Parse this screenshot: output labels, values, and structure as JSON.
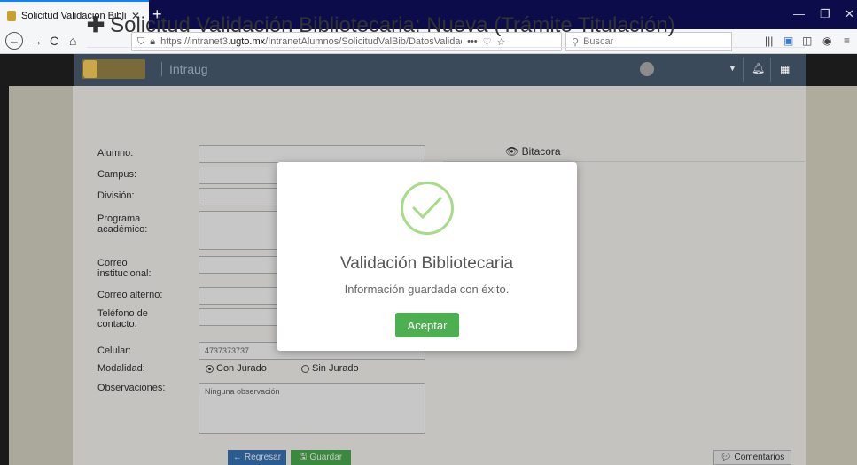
{
  "browser": {
    "tab_title": "Solicitud Validación Bibliotecar",
    "tab_close": "✕",
    "new_tab": "+",
    "url_prefix": "https://intranet3.",
    "url_domain": "ugto.mx",
    "url_path": "/IntranetAlumnos/SolicitudValBib/DatosValidacionTid...",
    "url_more": "•••",
    "search_placeholder": "Buscar",
    "window_controls": [
      "—",
      "❐",
      "✕"
    ]
  },
  "header": {
    "brand": "Intraug"
  },
  "page": {
    "title": "Solicitud Validación Bibliotecaria: Nueva (Trámite Titulación)",
    "bitacora": "Bitacora",
    "form": {
      "alumno_label": "Alumno:",
      "campus_label": "Campus:",
      "division_label": "División:",
      "programa_label": "Programa académico:",
      "correo_inst_label": "Correo institucional:",
      "correo_alt_label": "Correo alterno:",
      "telefono_label": "Teléfono de contacto:",
      "celular_label": "Celular:",
      "celular_value": "4737373737",
      "modalidad_label": "Modalidad:",
      "modalidad_options": [
        "Con Jurado",
        "Sin Jurado"
      ],
      "modalidad_selected": "Con Jurado",
      "observaciones_label": "Observaciones:",
      "observaciones_value": "Ninguna observación"
    },
    "buttons": {
      "regresar": "Regresar",
      "guardar": "Guardar",
      "comentarios": "Comentarios"
    }
  },
  "modal": {
    "title": "Validación Bibliotecaria",
    "message": "Información guardada con éxito.",
    "confirm": "Aceptar"
  },
  "colors": {
    "success_green": "#4caf50",
    "check_green": "#a5dc86",
    "primary_blue": "#3875b8",
    "header_bg": "#3b4a5a"
  }
}
